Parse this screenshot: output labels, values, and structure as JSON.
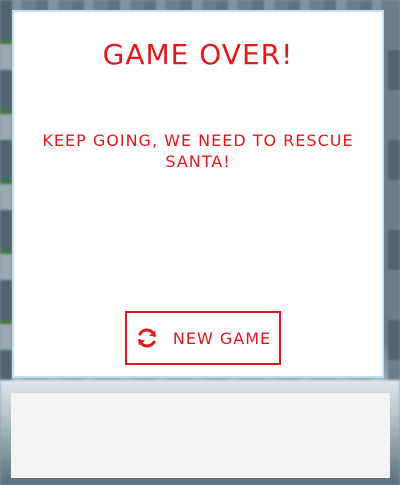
{
  "modal": {
    "title": "GAME OVER!",
    "message": "KEEP GOING, WE NEED TO RESCUE SANTA!",
    "button": {
      "label": "NEW GAME",
      "icon": "refresh-icon"
    }
  },
  "colors": {
    "accent": "#e8161c",
    "modal_background": "#ffffff",
    "modal_border": "#bfe3f5",
    "panel_background": "#f4f4f4"
  }
}
